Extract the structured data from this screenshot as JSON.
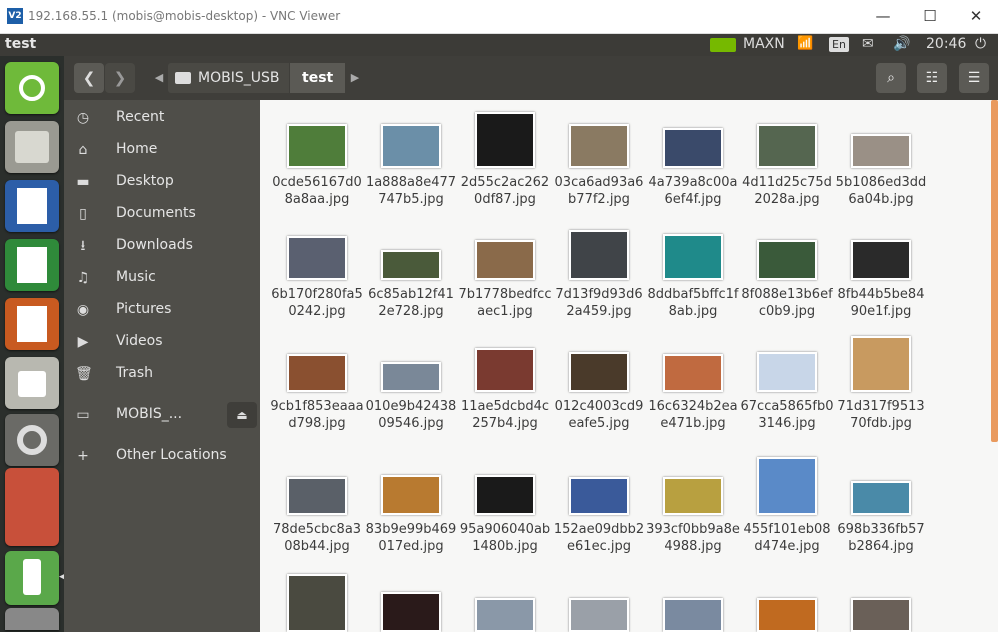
{
  "vnc": {
    "icon": "V2",
    "title": "192.168.55.1 (mobis@mobis-desktop) - VNC Viewer",
    "minimize": "—",
    "maximize": "☐",
    "close": "✕"
  },
  "topbar": {
    "window_title": "test",
    "maxn_label": "MAXN",
    "keyboard_label": "En",
    "time": "20:46"
  },
  "sidebar": {
    "items": [
      {
        "label": "Recent",
        "icon": "clock-icon"
      },
      {
        "label": "Home",
        "icon": "home-icon"
      },
      {
        "label": "Desktop",
        "icon": "folder-icon"
      },
      {
        "label": "Documents",
        "icon": "document-icon"
      },
      {
        "label": "Downloads",
        "icon": "download-icon"
      },
      {
        "label": "Music",
        "icon": "music-icon"
      },
      {
        "label": "Pictures",
        "icon": "camera-icon"
      },
      {
        "label": "Videos",
        "icon": "video-icon"
      },
      {
        "label": "Trash",
        "icon": "trash-icon"
      },
      {
        "label": "MOBIS_...",
        "icon": "drive-icon"
      },
      {
        "label": "Other Locations",
        "icon": "plus-icon"
      }
    ]
  },
  "pathbar": {
    "crumbs": [
      {
        "label": "MOBIS_USB"
      },
      {
        "label": "test"
      }
    ]
  },
  "colors": {
    "accent": "#e99a5e",
    "launcher_bg": "#2b2f2c",
    "sidebar_bg": "#4f4e49"
  },
  "files": [
    {
      "name": "0cde56167d08a8aa.jpg",
      "color": "#4f7d3a"
    },
    {
      "name": "1a888a8e477747b5.jpg",
      "color": "#6b8fa8"
    },
    {
      "name": "2d55c2ac2620df87.jpg",
      "color": "#1a1a1a"
    },
    {
      "name": "03ca6ad93a6b77f2.jpg",
      "color": "#8a7a62"
    },
    {
      "name": "4a739a8c00a6ef4f.jpg",
      "color": "#3a4a6a"
    },
    {
      "name": "4d11d25c75d2028a.jpg",
      "color": "#556650"
    },
    {
      "name": "5b1086ed3dd6a04b.jpg",
      "color": "#9a9086"
    },
    {
      "name": "6b170f280fa50242.jpg",
      "color": "#5a6070"
    },
    {
      "name": "6c85ab12f412e728.jpg",
      "color": "#4a5a3a"
    },
    {
      "name": "7b1778bedfccaec1.jpg",
      "color": "#8a6a4a"
    },
    {
      "name": "7d13f9d93d62a459.jpg",
      "color": "#404448"
    },
    {
      "name": "8ddbaf5bffc1f8ab.jpg",
      "color": "#1f8a8a"
    },
    {
      "name": "8f088e13b6efc0b9.jpg",
      "color": "#3a5a3a"
    },
    {
      "name": "8fb44b5be8490e1f.jpg",
      "color": "#2a2a2a"
    },
    {
      "name": "9cb1f853eaaad798.jpg",
      "color": "#8a5030"
    },
    {
      "name": "010e9b4243809546.jpg",
      "color": "#7a8898"
    },
    {
      "name": "11ae5dcbd4c257b4.jpg",
      "color": "#7a3a30"
    },
    {
      "name": "012c4003cd9eafe5.jpg",
      "color": "#4a3a2a"
    },
    {
      "name": "16c6324b2eae471b.jpg",
      "color": "#c06a40"
    },
    {
      "name": "67cca5865fb03146.jpg",
      "color": "#c8d6e8"
    },
    {
      "name": "71d317f951370fdb.jpg",
      "color": "#c89a60"
    },
    {
      "name": "78de5cbc8a308b44.jpg",
      "color": "#5a6068"
    },
    {
      "name": "83b9e99b469017ed.jpg",
      "color": "#b87a30"
    },
    {
      "name": "95a906040ab1480b.jpg",
      "color": "#1a1a1a"
    },
    {
      "name": "152ae09dbb2e61ec.jpg",
      "color": "#3a5a9a"
    },
    {
      "name": "393cf0bb9a8e4988.jpg",
      "color": "#b8a040"
    },
    {
      "name": "455f101eb08d474e.jpg",
      "color": "#5a8ac8"
    },
    {
      "name": "698b336fb57b2864.jpg",
      "color": "#4a8aa8"
    },
    {
      "name": "",
      "color": "#4a4a40"
    },
    {
      "name": "",
      "color": "#2a1a1a"
    },
    {
      "name": "",
      "color": "#8a98a8"
    },
    {
      "name": "",
      "color": "#9aa0a8"
    },
    {
      "name": "",
      "color": "#7a8aa0"
    },
    {
      "name": "",
      "color": "#c06a20"
    },
    {
      "name": "",
      "color": "#6a6058"
    }
  ]
}
